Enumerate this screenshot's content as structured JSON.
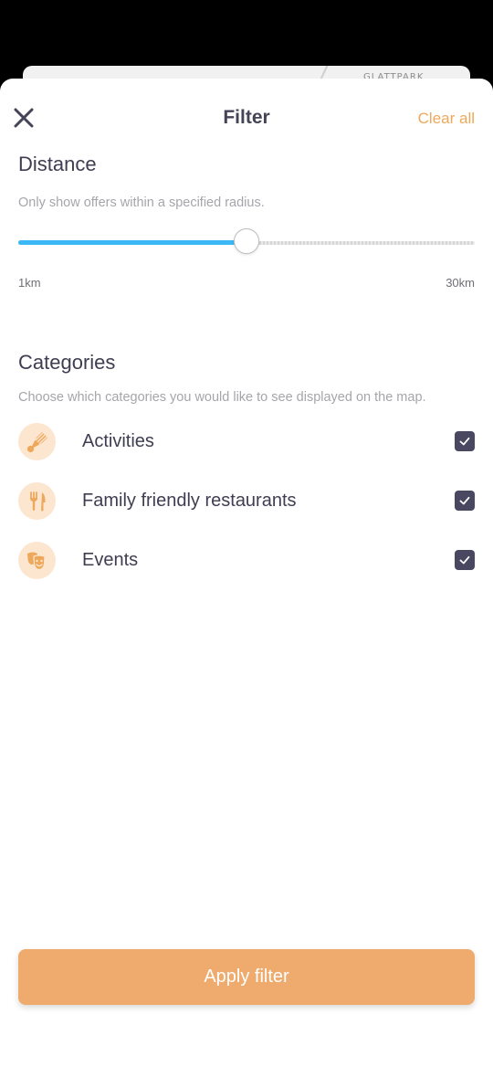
{
  "background_map": {
    "place_label": "GLATTPARK"
  },
  "header": {
    "title": "Filter",
    "clear_label": "Clear all",
    "close_icon": "close-icon"
  },
  "distance": {
    "title": "Distance",
    "description": "Only show offers within a specified radius.",
    "min_label": "1km",
    "max_label": "30km",
    "fraction": 0.5,
    "accent_color": "#3cb8f6"
  },
  "categories": {
    "title": "Categories",
    "description": "Choose which categories you would like to see displayed on the map.",
    "items": [
      {
        "label": "Activities",
        "icon": "shuttlecock-icon",
        "checked": true
      },
      {
        "label": "Family friendly restaurants",
        "icon": "fork-knife-icon",
        "checked": true
      },
      {
        "label": "Events",
        "icon": "theater-masks-icon",
        "checked": true
      }
    ]
  },
  "apply": {
    "label": "Apply filter",
    "color": "#efab6e"
  },
  "colors": {
    "accent_orange": "#eea85c",
    "icon_bg": "#fde6cf",
    "checkbox": "#4a4860",
    "text_dark": "#3f3d51"
  }
}
